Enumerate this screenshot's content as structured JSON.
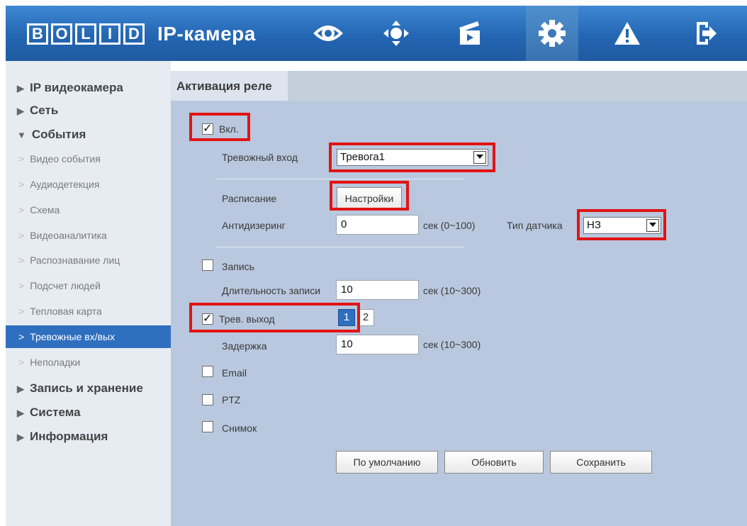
{
  "header": {
    "logo_text": [
      "B",
      "O",
      "L",
      "I",
      "D"
    ],
    "title": "IP-камера",
    "icons": [
      "eye-icon",
      "ptz-icon",
      "playback-icon",
      "gear-icon",
      "alarm-icon",
      "logout-icon"
    ],
    "active_icon": "gear-icon",
    "accent": "#2466b3"
  },
  "sidebar": {
    "sections": [
      {
        "label": "IP видеокамера",
        "expanded": false
      },
      {
        "label": "Сеть",
        "expanded": false
      },
      {
        "label": "События",
        "expanded": true
      },
      {
        "label": "Запись и хранение",
        "expanded": false
      },
      {
        "label": "Система",
        "expanded": false
      },
      {
        "label": "Информация",
        "expanded": false
      }
    ],
    "items": [
      {
        "label": "Видео события"
      },
      {
        "label": "Аудиодетекция"
      },
      {
        "label": "Схема"
      },
      {
        "label": "Видеоаналитика"
      },
      {
        "label": "Распознавание лиц"
      },
      {
        "label": "Подсчет людей"
      },
      {
        "label": "Тепловая карта"
      },
      {
        "label": "Тревожные вх/вых"
      },
      {
        "label": "Неполадки"
      }
    ],
    "active_item": "Тревожные вх/вых"
  },
  "tab": {
    "label": "Активация реле"
  },
  "form": {
    "enable": {
      "label": "Вкл.",
      "checked": true
    },
    "alarm_input": {
      "label": "Тревожный вход",
      "value": "Тревога1"
    },
    "schedule": {
      "label": "Расписание",
      "button": "Настройки"
    },
    "debounce": {
      "label": "Антидизеринг",
      "value": "0",
      "unit": "сек (0~100)"
    },
    "sensor_type": {
      "label": "Тип датчика",
      "value": "НЗ"
    },
    "record": {
      "label": "Запись",
      "checked": false
    },
    "record_duration": {
      "label": "Длительность записи",
      "value": "10",
      "unit": "сек (10~300)"
    },
    "alarm_out": {
      "label": "Трев. выход",
      "checked": true,
      "pages": [
        "1",
        "2"
      ],
      "active_page": "1"
    },
    "delay": {
      "label": "Задержка",
      "value": "10",
      "unit": "сек (10~300)"
    },
    "email": {
      "label": "Email",
      "checked": false
    },
    "ptz": {
      "label": "PTZ",
      "checked": false
    },
    "snapshot": {
      "label": "Снимок",
      "checked": false
    }
  },
  "buttons": {
    "default": "По умолчанию",
    "refresh": "Обновить",
    "save": "Сохранить"
  }
}
